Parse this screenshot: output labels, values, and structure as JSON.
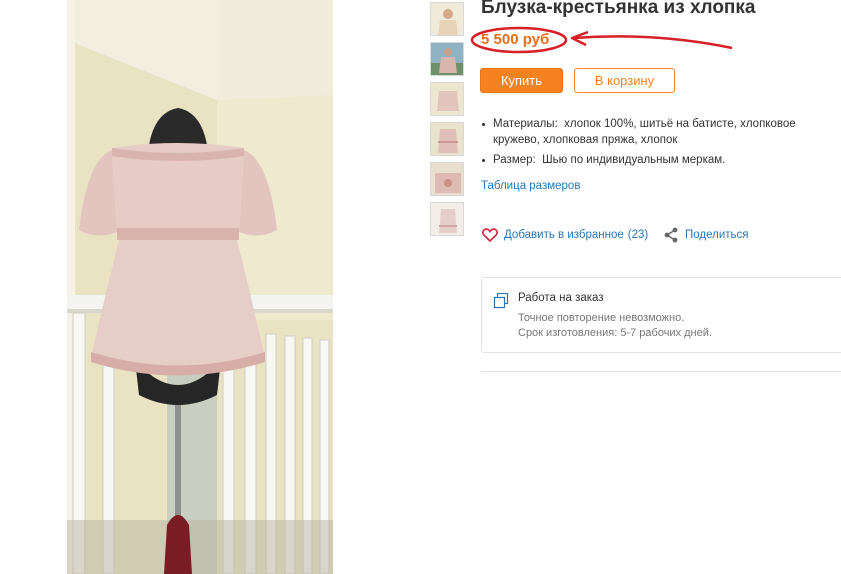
{
  "product": {
    "title": "Блузка-крестьянка из хлопка",
    "price": "5 500 руб"
  },
  "buttons": {
    "buy": "Купить",
    "cart": "В корзину"
  },
  "properties": [
    {
      "label": "Материалы:",
      "value": "хлопок 100%, шитьё на батисте, хлопковое кружево, хлопковая пряжа, хлопок"
    },
    {
      "label": "Размер:",
      "value": "Шью по индивидуальным меркам."
    }
  ],
  "links": {
    "size_table": "Таблица размеров",
    "favorite": "Добавить в избранное",
    "favorite_count": "(23)",
    "share": "Поделиться"
  },
  "order": {
    "title": "Работа на заказ",
    "line1": "Точное повторение невозможно.",
    "line2": "Срок изготовления: 5-7 рабочих дней."
  },
  "colors": {
    "accent": "#f5821f",
    "price": "#e56f1a",
    "link": "#2677b8",
    "annotation": "#d61f26"
  },
  "thumbnail_count": 6
}
